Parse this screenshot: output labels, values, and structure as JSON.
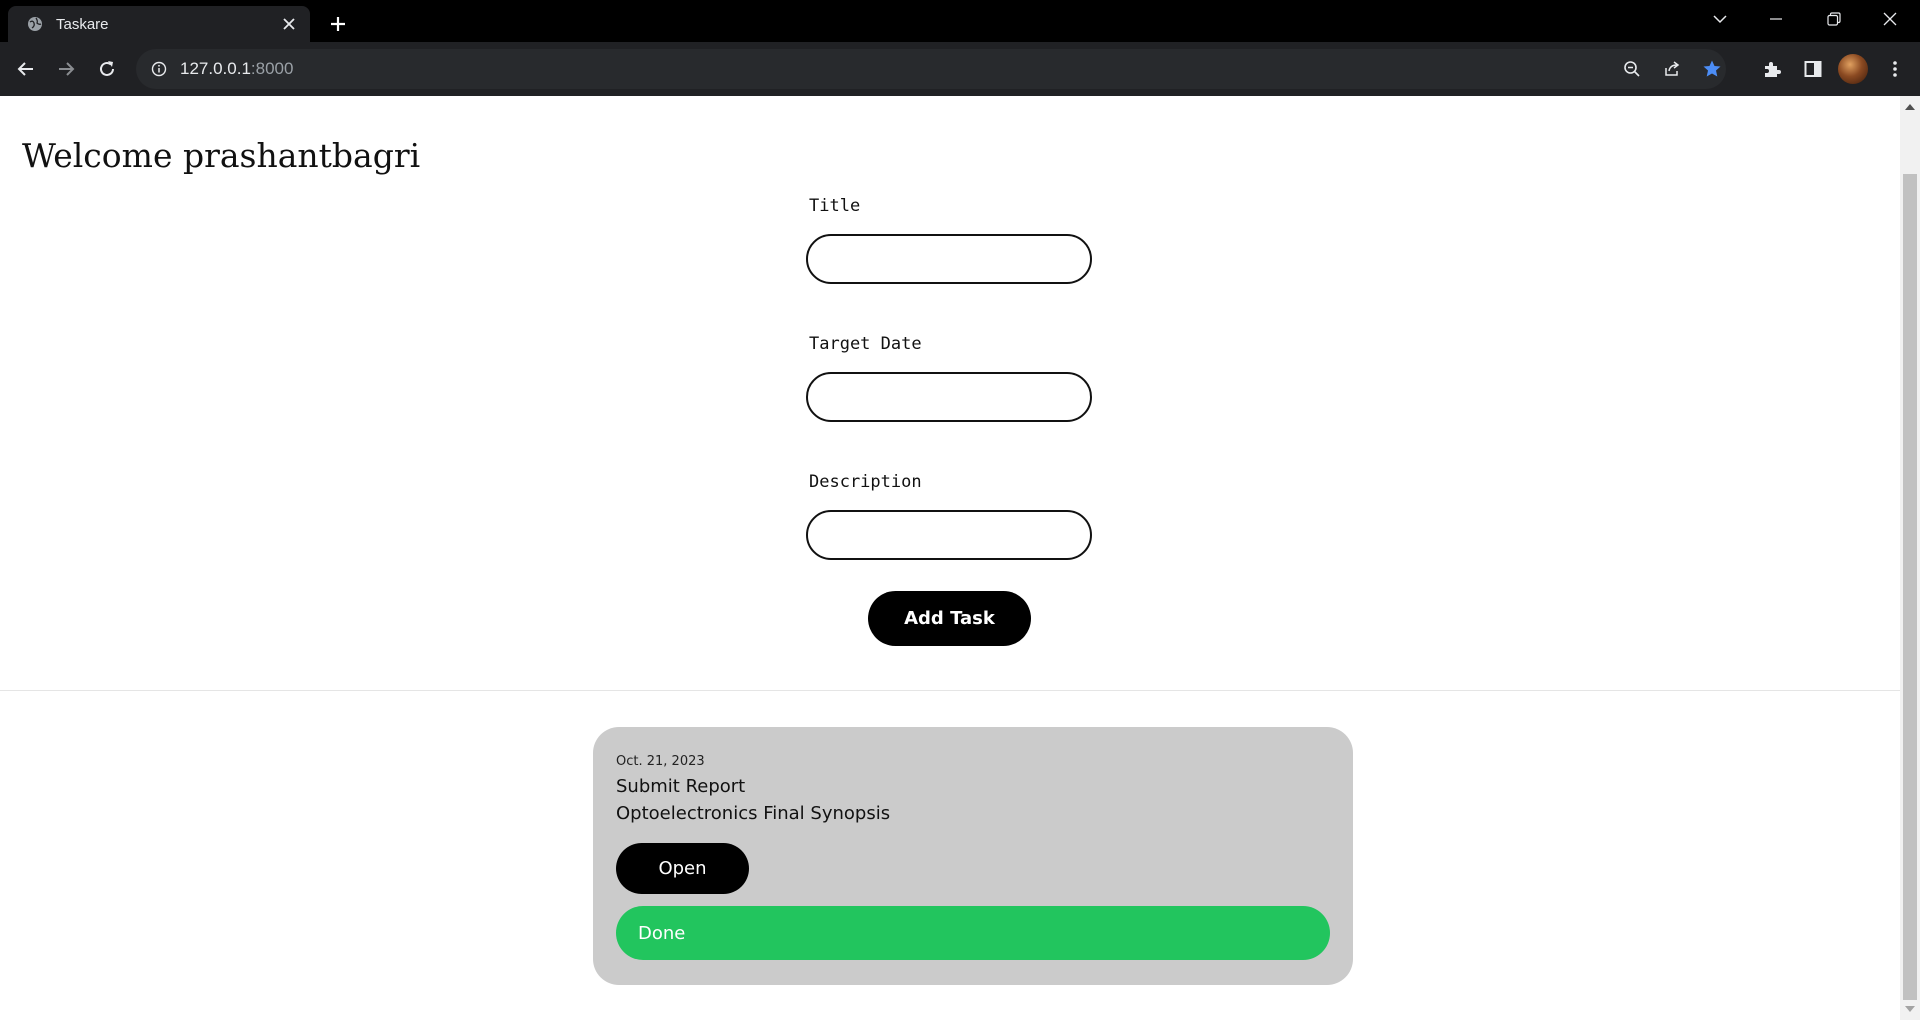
{
  "browser": {
    "tab_title": "Taskare",
    "url_host": "127.0.0.1",
    "url_port": ":8000",
    "icons": {
      "favicon": "globe-icon",
      "close": "close-icon",
      "new_tab": "plus-icon",
      "back": "back-arrow-icon",
      "forward": "forward-arrow-icon",
      "reload": "reload-icon",
      "info": "info-icon",
      "zoom": "zoom-out-icon",
      "share": "share-icon",
      "bookmark": "star-icon",
      "extensions": "puzzle-icon",
      "side_panel": "side-panel-icon",
      "menu": "kebab-menu-icon",
      "tab_search": "chevron-down-icon",
      "minimize": "minimize-icon",
      "restore": "restore-icon",
      "window_close": "close-icon"
    },
    "colors": {
      "bookmark_star": "#4c8df6"
    }
  },
  "header": {
    "welcome": "Welcome prashantbagri"
  },
  "form": {
    "title_label": "Title",
    "title_value": "",
    "target_date_label": "Target Date",
    "target_date_value": "",
    "description_label": "Description",
    "description_value": "",
    "submit_label": "Add Task"
  },
  "tasks": [
    {
      "date": "Oct. 21, 2023",
      "title": "Submit Report",
      "description": "Optoelectronics Final Synopsis",
      "open_label": "Open",
      "done_label": "Done"
    }
  ],
  "colors": {
    "card_bg": "#cbcbcb",
    "done_green": "#22c55e",
    "primary_button": "#000000"
  }
}
